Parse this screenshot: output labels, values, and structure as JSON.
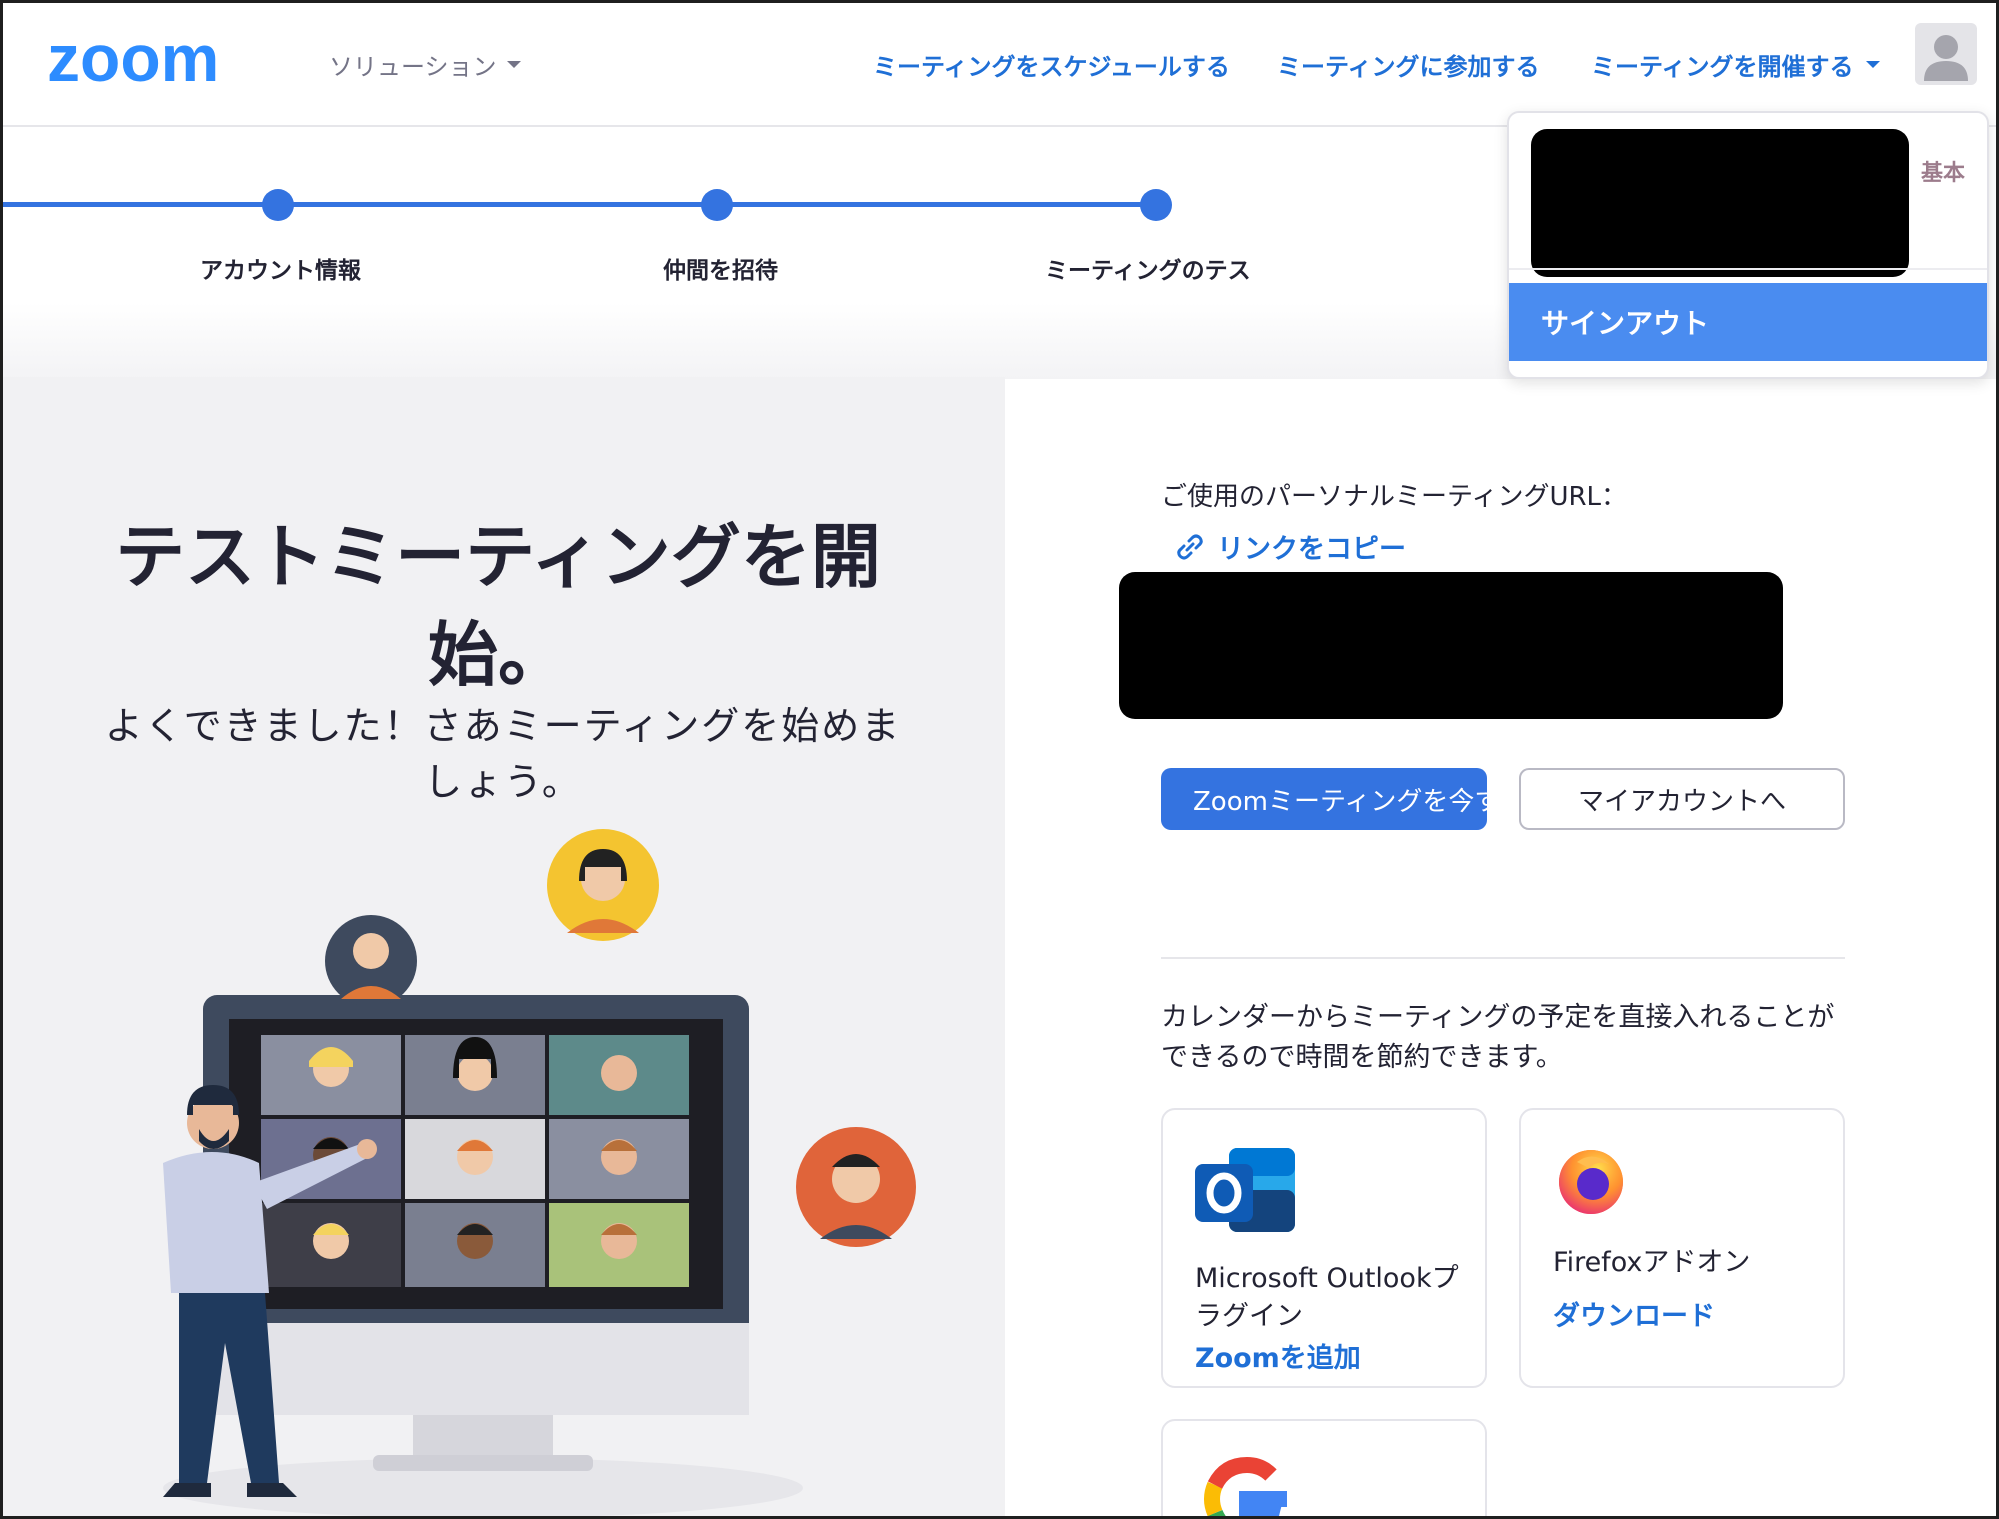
{
  "header": {
    "logo_text": "zoom",
    "solutions_label": "ソリューション",
    "schedule_label": "ミーティングをスケジュールする",
    "join_label": "ミーティングに参加する",
    "host_label": "ミーティングを開催する"
  },
  "stepper": {
    "steps": [
      {
        "label": "アカウント情報"
      },
      {
        "label": "仲間を招待"
      },
      {
        "label": "ミーティングのテス"
      }
    ]
  },
  "dropdown": {
    "plan_label": "基本",
    "signout_label": "サインアウト"
  },
  "hero": {
    "title_line1": "テストミーティングを開",
    "title_line2": "始。",
    "subtitle_line1": "よくできました！さあミーティングを始めま",
    "subtitle_line2": "しょう。"
  },
  "personal_url": {
    "label": "ご使用のパーソナルミーティングURL：",
    "copy_label": "リンクをコピー"
  },
  "actions": {
    "start_label": "Zoomミーティングを今すぐ開始",
    "account_label": "マイアカウントへ"
  },
  "calendar": {
    "text_line1": "カレンダーからミーティングの予定を直接入れることが",
    "text_line2": "できるので時間を節約できます。",
    "cards": [
      {
        "title_line1": "Microsoft Outlookプ",
        "title_line2": "ラグイン",
        "link": "Zoomを追加",
        "icon": "outlook-icon"
      },
      {
        "title_line1": "Firefoxアドオン",
        "title_line2": "",
        "link": "ダウンロード",
        "icon": "firefox-icon"
      },
      {
        "title_line1": "",
        "title_line2": "",
        "link": "",
        "icon": "google-icon"
      }
    ]
  },
  "colors": {
    "brand_blue": "#2D8CFF",
    "accent_blue": "#3473E0",
    "link_blue": "#1F6FD6",
    "signout_bg": "#4A8CF0",
    "panel_grey": "#F1F1F3"
  }
}
